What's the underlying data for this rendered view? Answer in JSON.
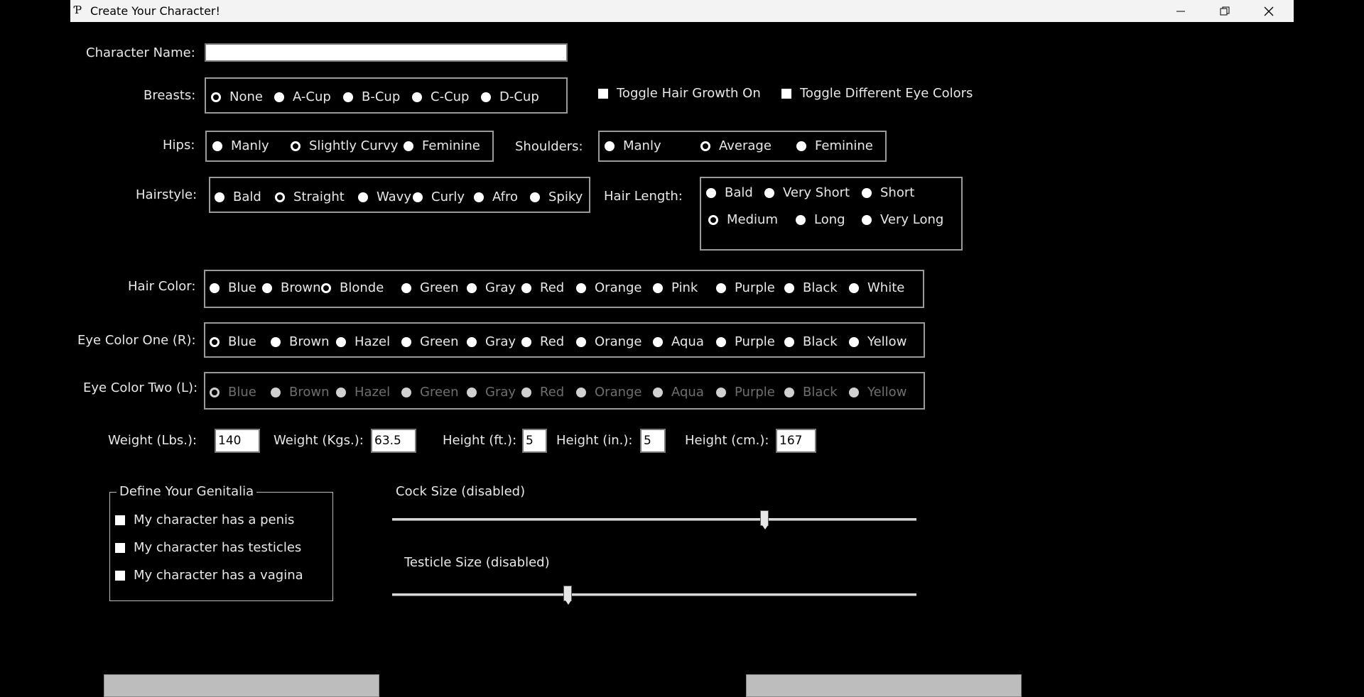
{
  "window": {
    "title": "Create Your Character!",
    "app_icon": "Ƥ"
  },
  "name": {
    "label": "Character Name:",
    "value": ""
  },
  "breasts": {
    "label": "Breasts:",
    "options": [
      "None",
      "A-Cup",
      "B-Cup",
      "C-Cup",
      "D-Cup"
    ],
    "selected": "None"
  },
  "toggles": {
    "hair_growth": "Toggle Hair Growth On",
    "diff_eyes": "Toggle Different Eye Colors"
  },
  "hips": {
    "label": "Hips:",
    "options": [
      "Manly",
      "Slightly Curvy",
      "Feminine"
    ],
    "selected": "Slightly Curvy"
  },
  "shoulders": {
    "label": "Shoulders:",
    "options": [
      "Manly",
      "Average",
      "Feminine"
    ],
    "selected": "Average"
  },
  "hairstyle": {
    "label": "Hairstyle:",
    "options": [
      "Bald",
      "Straight",
      "Wavy",
      "Curly",
      "Afro",
      "Spiky"
    ],
    "selected": "Straight"
  },
  "hair_length": {
    "label": "Hair Length:",
    "options": [
      "Bald",
      "Very Short",
      "Short",
      "Medium",
      "Long",
      "Very Long"
    ],
    "selected": "Medium"
  },
  "hair_color": {
    "label": "Hair Color:",
    "options": [
      "Blue",
      "Brown",
      "Blonde",
      "Green",
      "Gray",
      "Red",
      "Orange",
      "Pink",
      "Purple",
      "Black",
      "White"
    ],
    "selected": "Blonde"
  },
  "eye_one": {
    "label": "Eye Color One (R):",
    "options": [
      "Blue",
      "Brown",
      "Hazel",
      "Green",
      "Gray",
      "Red",
      "Orange",
      "Aqua",
      "Purple",
      "Black",
      "Yellow"
    ],
    "selected": "Blue"
  },
  "eye_two": {
    "label": "Eye Color Two (L):",
    "options": [
      "Blue",
      "Brown",
      "Hazel",
      "Green",
      "Gray",
      "Red",
      "Orange",
      "Aqua",
      "Purple",
      "Black",
      "Yellow"
    ],
    "selected": "Blue",
    "disabled": true
  },
  "measurements": {
    "weight_lbs": {
      "label": "Weight (Lbs.):",
      "value": "140"
    },
    "weight_kgs": {
      "label": "Weight (Kgs.):",
      "value": "63.5"
    },
    "height_ft": {
      "label": "Height (ft.):",
      "value": "5"
    },
    "height_in": {
      "label": "Height (in.):",
      "value": "5"
    },
    "height_cm": {
      "label": "Height (cm.):",
      "value": "167"
    }
  },
  "genitalia": {
    "title": "Define Your Genitalia",
    "items": [
      "My character has a penis",
      "My character has testicles",
      "My character has a vagina"
    ]
  },
  "sliders": {
    "cock": {
      "label": "Cock Size (disabled)",
      "fraction": 0.71
    },
    "testicle": {
      "label": "Testicle Size (disabled)",
      "fraction": 0.335
    }
  },
  "icons": {
    "minimize": "minimize-icon",
    "maximize": "restore-icon",
    "close": "close-icon"
  }
}
